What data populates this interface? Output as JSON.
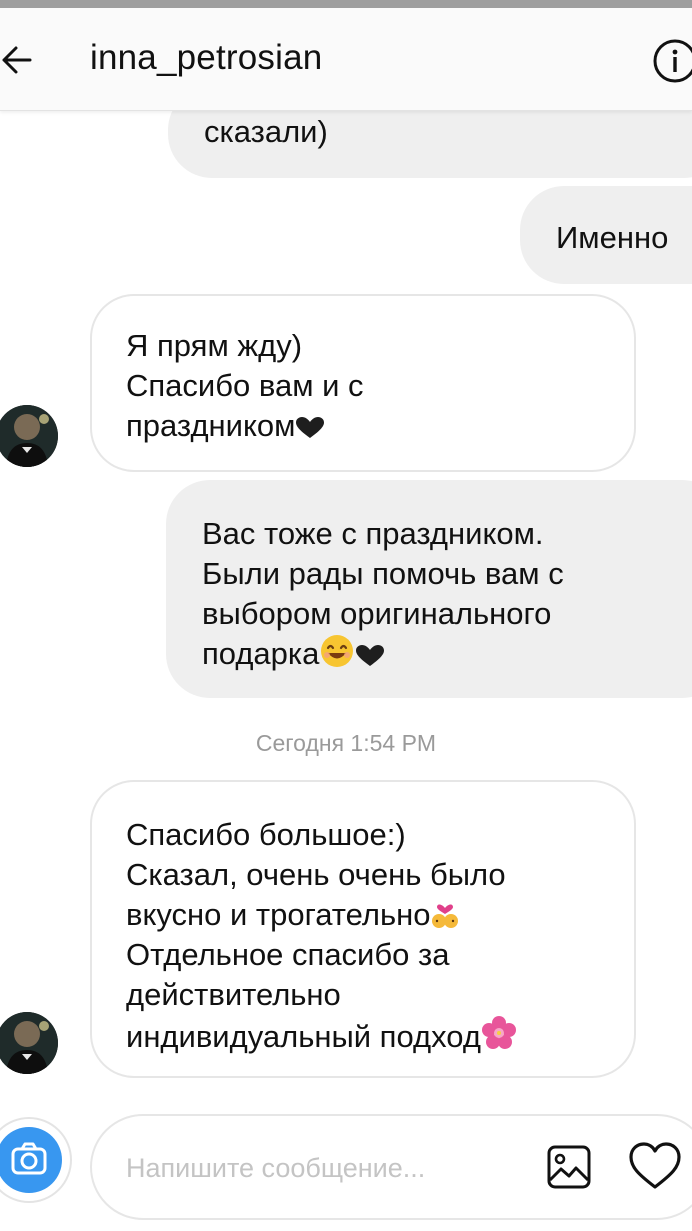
{
  "header": {
    "username": "inna_petrosian",
    "back_icon": "arrow-left-icon",
    "info_icon": "info-circle-icon"
  },
  "messages": [
    {
      "direction": "outgoing",
      "lines": [
        "сказали)"
      ]
    },
    {
      "direction": "outgoing",
      "lines": [
        "Именно"
      ]
    },
    {
      "direction": "incoming",
      "lines": [
        "Я прям жду)",
        "Спасибо вам и с",
        "праздником"
      ],
      "trailing_icons": [
        "black-heart-icon"
      ]
    },
    {
      "direction": "outgoing",
      "lines": [
        "Вас тоже с праздником.",
        "Были рады помочь вам с",
        "выбором оригинального",
        "подарка"
      ],
      "trailing_icons": [
        "smiling-face-icon",
        "black-heart-icon"
      ]
    },
    {
      "direction": "incoming",
      "lines": [
        "Спасибо большое:)",
        "Сказал, очень очень было",
        "вкусно и трогательно",
        "Отдельное спасибо за",
        "действительно",
        "индивидуальный подход"
      ],
      "inline_icons": [
        "couple-kiss-icon",
        "cherry-blossom-icon"
      ]
    }
  ],
  "timestamp": "Сегодня 1:54 PM",
  "composer": {
    "placeholder": "Напишите сообщение...",
    "camera_icon": "camera-icon",
    "gallery_icon": "gallery-icon",
    "like_icon": "heart-outline-icon"
  },
  "colors": {
    "outgoing_bubble": "#efefef",
    "incoming_border": "#e6e6e6",
    "camera_blue": "#3897f0",
    "timestamp_gray": "#9a9a9a"
  }
}
